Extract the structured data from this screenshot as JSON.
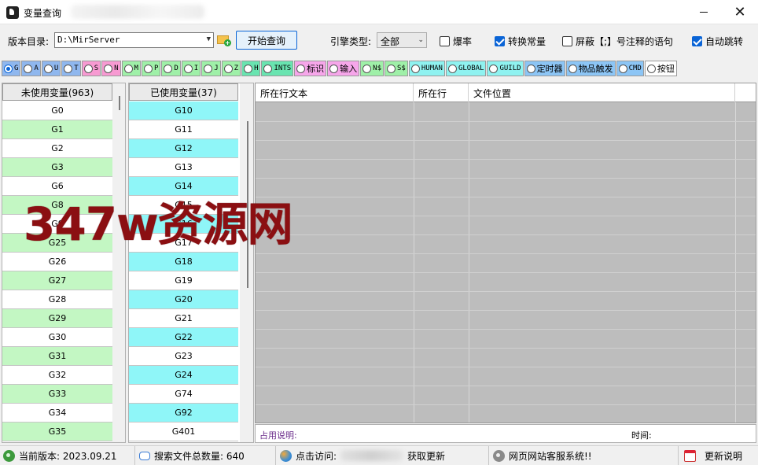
{
  "window": {
    "title": "变量查询"
  },
  "toolbar": {
    "dir_label": "版本目录:",
    "dir_value": "D:\\MirServer",
    "query_button": "开始查询",
    "engine_label": "引擎类型:",
    "engine_value": "全部",
    "checks": [
      {
        "label": "爆率",
        "checked": false
      },
      {
        "label": "转换常量",
        "checked": true
      },
      {
        "label": "屏蔽【;】号注释的语句",
        "checked": false
      },
      {
        "label": "自动跳转",
        "checked": true
      }
    ]
  },
  "radios": [
    {
      "label": "G",
      "color": "c-blue",
      "selected": true
    },
    {
      "label": "A",
      "color": "c-blue"
    },
    {
      "label": "U",
      "color": "c-blue"
    },
    {
      "label": "T",
      "color": "c-blue"
    },
    {
      "label": "S",
      "color": "c-pink"
    },
    {
      "label": "N",
      "color": "c-pink"
    },
    {
      "label": "M",
      "color": "c-green"
    },
    {
      "label": "P",
      "color": "c-green"
    },
    {
      "label": "D",
      "color": "c-green"
    },
    {
      "label": "I",
      "color": "c-green"
    },
    {
      "label": "J",
      "color": "c-green"
    },
    {
      "label": "Z",
      "color": "c-green"
    },
    {
      "label": "H",
      "color": "c-teal"
    },
    {
      "label": "INTS",
      "color": "c-teal"
    },
    {
      "label": "标识",
      "color": "c-mag",
      "cjk": true
    },
    {
      "label": "输入",
      "color": "c-mag",
      "cjk": true
    },
    {
      "label": "N$",
      "color": "c-green"
    },
    {
      "label": "S$",
      "color": "c-green"
    },
    {
      "label": "HUMAN",
      "color": "c-cyan"
    },
    {
      "label": "GLOBAL",
      "color": "c-cyan"
    },
    {
      "label": "GUILD",
      "color": "c-cyan"
    },
    {
      "label": "定时器",
      "color": "c-sky",
      "cjk": true
    },
    {
      "label": "物品触发",
      "color": "c-sky",
      "cjk": true
    },
    {
      "label": "CMD",
      "color": "c-sky"
    },
    {
      "label": "按钮",
      "color": "c-white",
      "cjk": true
    }
  ],
  "unused": {
    "header": "未使用变量(963)",
    "items": [
      "G0",
      "G1",
      "G2",
      "G3",
      "G6",
      "G8",
      "G9",
      "G25",
      "G26",
      "G27",
      "G28",
      "G29",
      "G30",
      "G31",
      "G32",
      "G33",
      "G34",
      "G35"
    ]
  },
  "used": {
    "header": "已使用变量(37)",
    "items": [
      "G10",
      "G11",
      "G12",
      "G13",
      "G14",
      "G15",
      "G16",
      "G17",
      "G18",
      "G19",
      "G20",
      "G21",
      "G22",
      "G23",
      "G24",
      "G74",
      "G92",
      "G401"
    ]
  },
  "grid": {
    "columns": [
      "所在行文本",
      "所在行",
      "文件位置"
    ]
  },
  "info": {
    "usage_label": "占用说明:",
    "time_label": "时间:"
  },
  "status": {
    "version": "当前版本: 2023.09.21",
    "file_count": "搜索文件总数量: 640",
    "visit_prefix": "点击访问:",
    "visit_suffix": "获取更新",
    "service": "网页网站客服系统!!",
    "changelog": "更新说明"
  },
  "watermark": "347w资源网",
  "colors": {
    "row_green": "#c3f7c3",
    "row_cyan": "#8ff6f8",
    "grid_gray": "#bdbdbd",
    "watermark": "#8b0f12"
  }
}
